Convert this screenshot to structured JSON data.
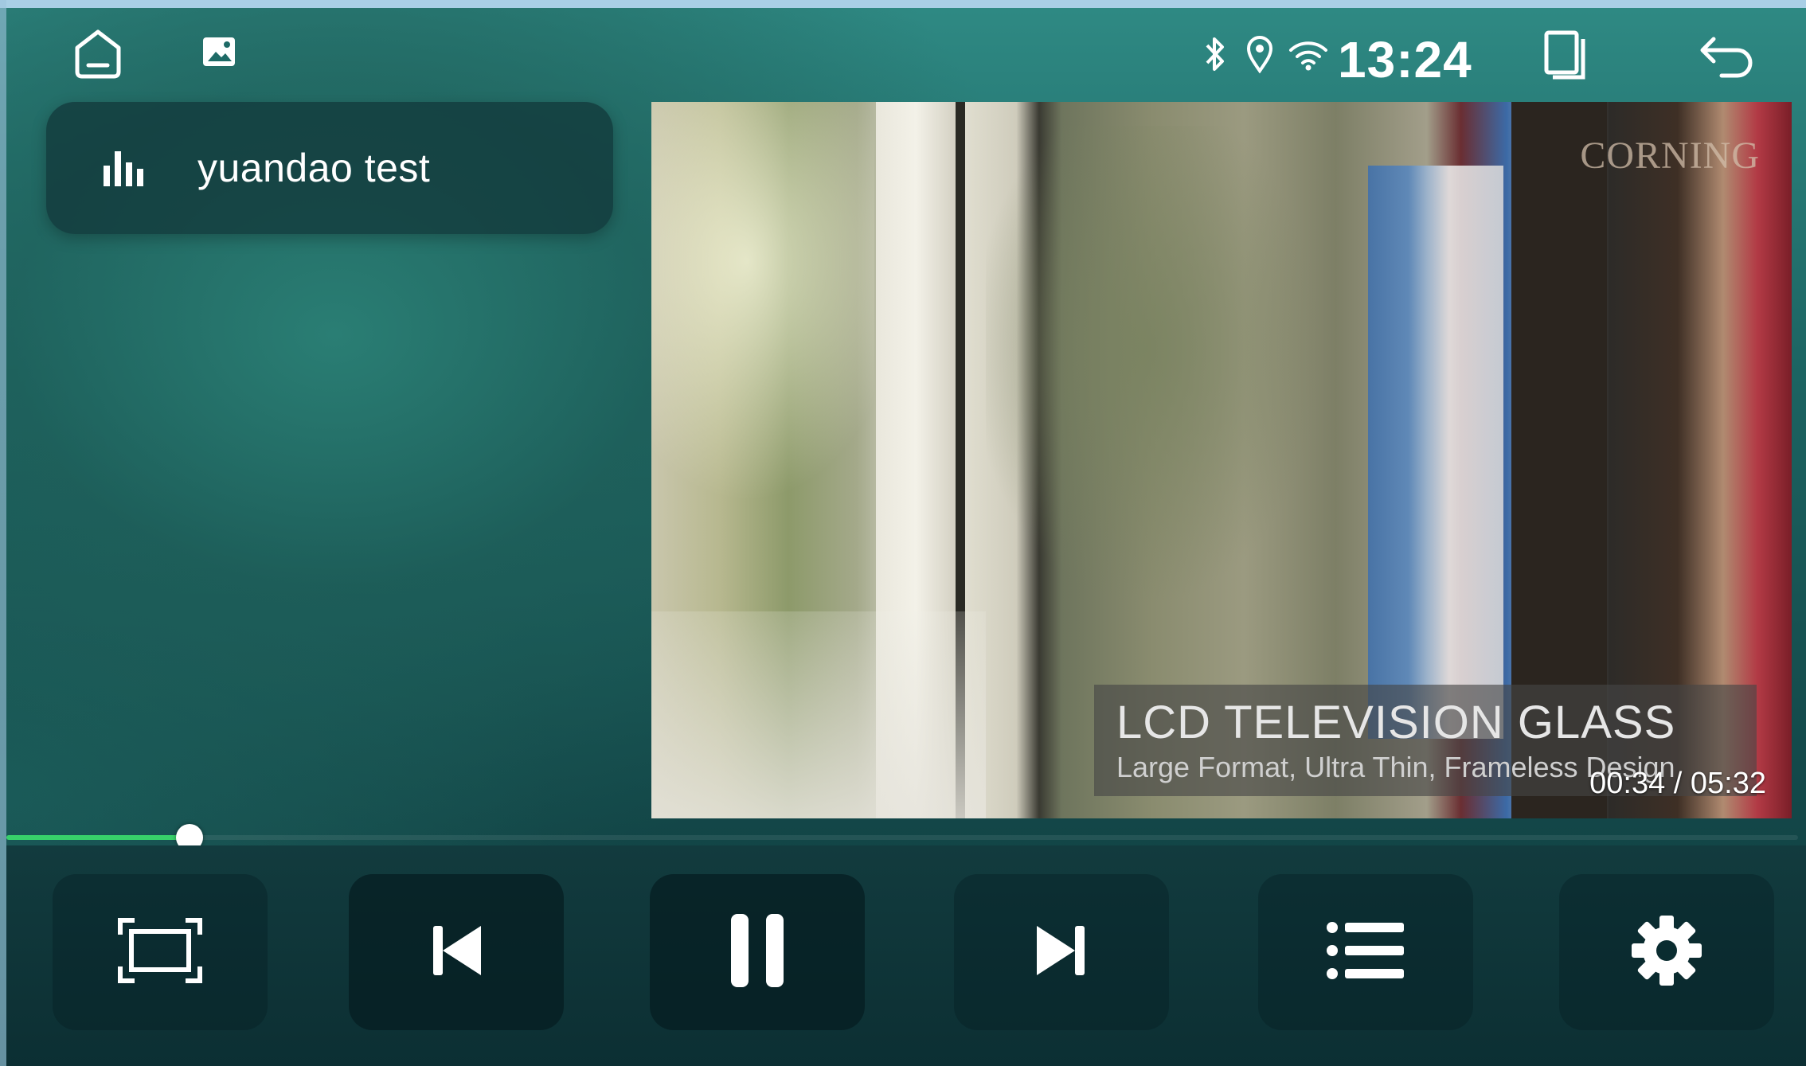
{
  "status_bar": {
    "time": "13:24",
    "left_icons": [
      "home-icon",
      "gallery-icon"
    ],
    "right_icons": [
      "bluetooth-icon",
      "location-icon",
      "wifi-icon",
      "recent-apps-icon",
      "back-icon"
    ]
  },
  "now_playing": {
    "title": "yuandao test",
    "icon": "equalizer-icon"
  },
  "video": {
    "watermark": "CORNING",
    "caption_title": "LCD TELEVISION GLASS",
    "caption_subtitle": "Large Format, Ultra Thin, Frameless Design",
    "timecode": "00:34 / 05:32"
  },
  "progress": {
    "position_seconds": 34,
    "duration_seconds": 332,
    "fill_color": "#37d16a"
  },
  "controls": [
    {
      "name": "aspect-ratio-button",
      "icon": "fullscreen-frame-icon"
    },
    {
      "name": "previous-button",
      "icon": "skip-previous-icon"
    },
    {
      "name": "pause-button",
      "icon": "pause-icon"
    },
    {
      "name": "next-button",
      "icon": "skip-next-icon"
    },
    {
      "name": "playlist-button",
      "icon": "list-icon"
    },
    {
      "name": "settings-button",
      "icon": "gear-icon"
    }
  ]
}
